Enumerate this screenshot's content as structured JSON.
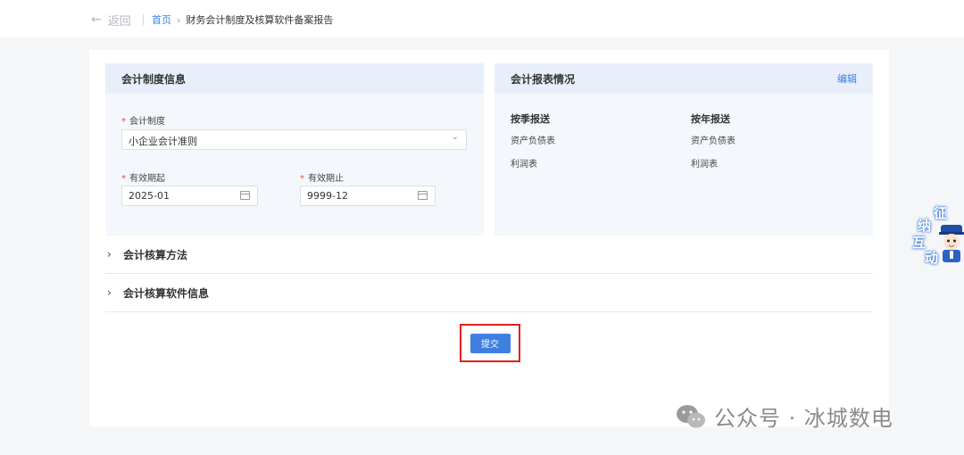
{
  "header": {
    "back_label": "返回",
    "breadcrumb": {
      "home": "首页",
      "separator": "›",
      "current": "财务会计制度及核算软件备案报告"
    }
  },
  "accounting_system": {
    "title": "会计制度信息",
    "system_label": "会计制度",
    "system_value": "小企业会计准则",
    "start_label": "有效期起",
    "start_value": "2025-01",
    "end_label": "有效期止",
    "end_value": "9999-12"
  },
  "reports": {
    "title": "会计报表情况",
    "edit_label": "编辑",
    "quarterly": {
      "heading": "按季报送",
      "items": [
        "资产负债表",
        "利润表"
      ]
    },
    "yearly": {
      "heading": "按年报送",
      "items": [
        "资产负债表",
        "利润表"
      ]
    }
  },
  "sections": [
    {
      "title": "会计核算方法"
    },
    {
      "title": "会计核算软件信息"
    }
  ],
  "submit_label": "提交",
  "mascot": {
    "chars": [
      "征",
      "纳",
      "互",
      "动"
    ]
  },
  "watermark": {
    "text": "公众号 · 冰城数电"
  },
  "colors": {
    "accent": "#3e7fe0",
    "required": "#e94a3c",
    "highlight_border": "#e02020",
    "panel_bg": "#f4f7fb",
    "panel_header_bg": "#e8effa"
  }
}
